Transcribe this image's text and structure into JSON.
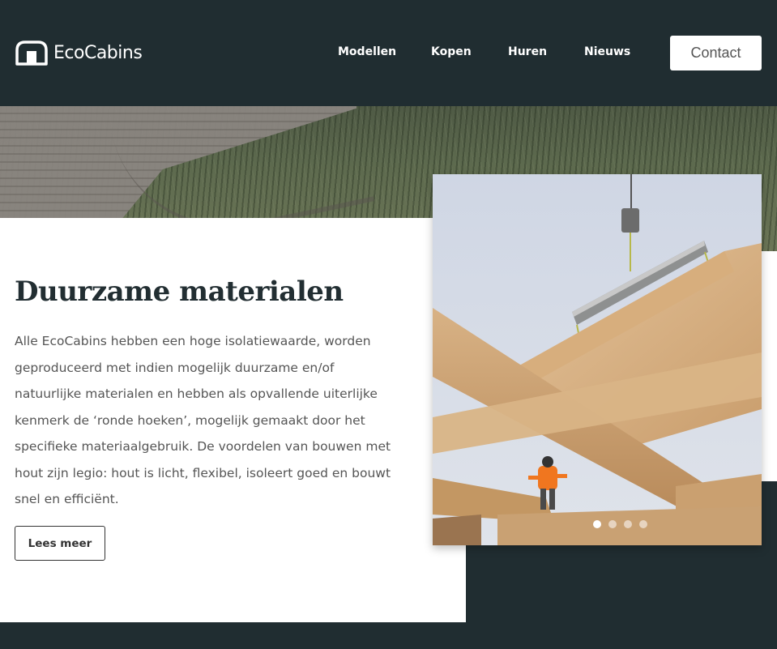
{
  "brand": {
    "name": "EcoCabins",
    "logo_icon": "cabin-logo-icon"
  },
  "nav": {
    "items": [
      {
        "label": "Modellen"
      },
      {
        "label": "Kopen"
      },
      {
        "label": "Huren"
      },
      {
        "label": "Nieuws"
      }
    ],
    "contact_label": "Contact"
  },
  "main": {
    "heading": "Duurzame materialen",
    "paragraph": "Alle EcoCabins hebben een hoge isolatiewaarde, worden geproduceerd met indien mogelijk duurzame en/of natuurlijke materialen en hebben als opvallende uiterlijke kenmerk de ‘ronde hoeken’, mogelijk gemaakt door het specifieke materiaalgebruik. De voordelen van bouwen met hout zijn legio: hout is licht, flexibel, isoleert goed en bouwt snel en efficiënt.",
    "cta_label": "Lees meer"
  },
  "carousel": {
    "slide_count": 4,
    "active_slide": 1
  },
  "colors": {
    "header_bg": "#202d31",
    "heading_text": "#222e32",
    "body_text": "#555555"
  }
}
